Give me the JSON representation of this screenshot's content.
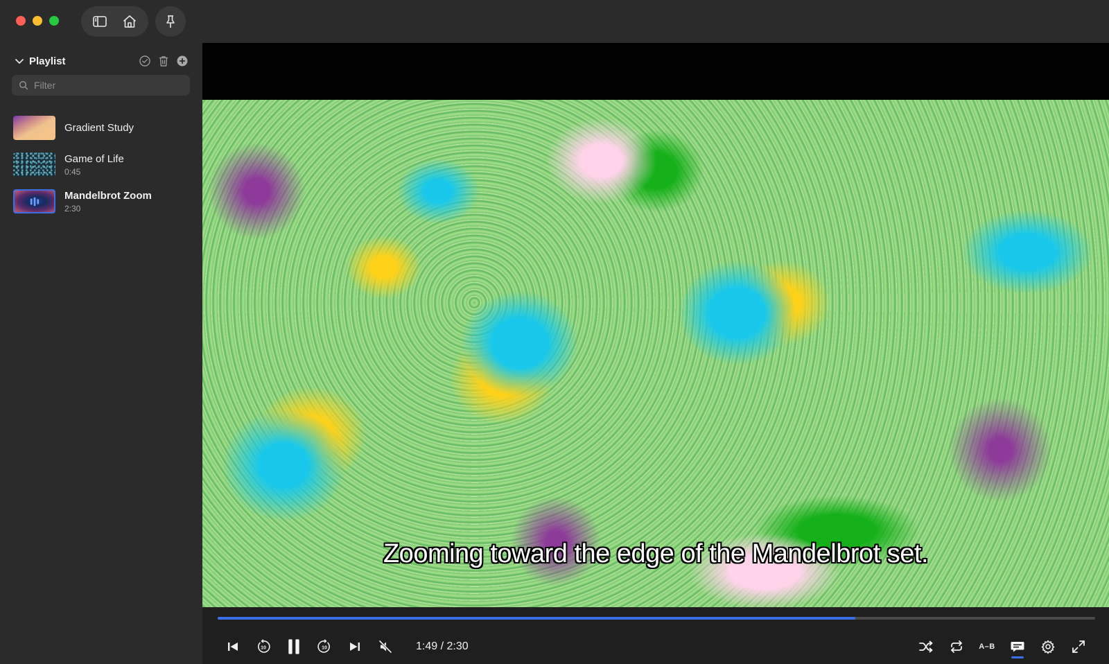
{
  "window": {
    "traffic_lights": {
      "close_color": "#ff5f57",
      "minimize_color": "#febc2e",
      "maximize_color": "#28c840"
    }
  },
  "toolbar": {
    "icons": [
      "sidebar-toggle-icon",
      "home-icon",
      "pin-icon"
    ]
  },
  "sidebar": {
    "playlist_title": "Playlist",
    "header_actions": [
      "checkmark-circle-icon",
      "trash-icon",
      "plus-circle-icon"
    ],
    "filter": {
      "placeholder": "Filter",
      "value": ""
    },
    "items": [
      {
        "name": "Gradient Study",
        "duration": "",
        "active": false
      },
      {
        "name": "Game of Life",
        "duration": "0:45",
        "active": false
      },
      {
        "name": "Mandelbrot Zoom",
        "duration": "2:30",
        "active": true
      }
    ]
  },
  "player": {
    "subtitle": "Zooming toward the edge of the Mandelbrot set.",
    "current_time": "1:49",
    "separator": " / ",
    "total_time": "2:30",
    "progress_fraction": 0.7267,
    "accent_color": "#3b6ee8",
    "left_controls": [
      "previous-icon",
      "rewind-10-icon",
      "pause-icon",
      "forward-10-icon",
      "next-icon",
      "muted-speaker-icon"
    ],
    "right_controls": [
      "shuffle-icon",
      "repeat-icon",
      "ab-loop",
      "subtitles-icon",
      "settings-gear-icon",
      "fullscreen-icon"
    ],
    "ab_label": "A–B"
  }
}
